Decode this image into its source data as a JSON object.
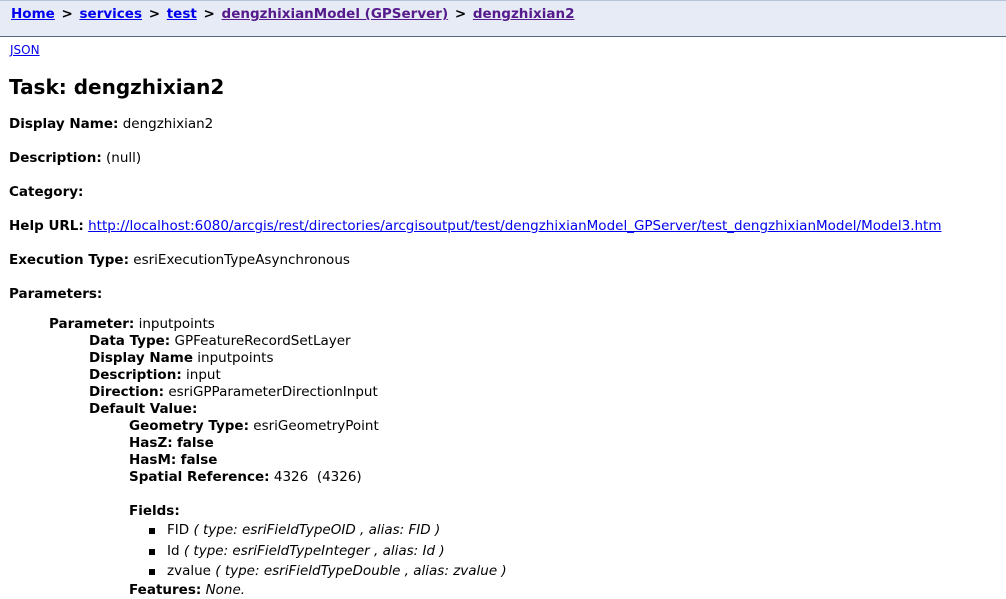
{
  "breadcrumb": {
    "items": [
      {
        "label": "Home",
        "visited": false
      },
      {
        "label": "services",
        "visited": false
      },
      {
        "label": "test",
        "visited": false
      },
      {
        "label": "dengzhixianModel (GPServer)",
        "visited": true
      },
      {
        "label": "dengzhixian2",
        "visited": true
      }
    ],
    "separator": ">"
  },
  "json_link": "JSON",
  "task": {
    "title": "Task: dengzhixian2",
    "display_name_label": "Display Name:",
    "display_name": "dengzhixian2",
    "description_label": "Description:",
    "description": "(null)",
    "category_label": "Category:",
    "category": "",
    "help_url_label": "Help URL:",
    "help_url": "http://localhost:6080/arcgis/rest/directories/arcgisoutput/test/dengzhixianModel_GPServer/test_dengzhixianModel/Model3.htm",
    "execution_type_label": "Execution Type:",
    "execution_type": "esriExecutionTypeAsynchronous",
    "parameters_label": "Parameters:"
  },
  "parameter": {
    "label": "Parameter:",
    "name": "inputpoints",
    "data_type_label": "Data Type:",
    "data_type": "GPFeatureRecordSetLayer",
    "display_name_label": "Display Name",
    "display_name": "inputpoints",
    "description_label": "Description:",
    "description": "input",
    "direction_label": "Direction:",
    "direction": "esriGPParameterDirectionInput",
    "default_value_label": "Default Value:",
    "default_value": {
      "geometry_type_label": "Geometry Type:",
      "geometry_type": "esriGeometryPoint",
      "hasz_label": "HasZ:",
      "hasz": "false",
      "hasm_label": "HasM:",
      "hasm": "false",
      "spatial_reference_label": "Spatial Reference:",
      "spatial_reference": "4326  (4326)",
      "fields_label": "Fields:",
      "fields": [
        {
          "name": "FID",
          "detail": "( type: esriFieldTypeOID , alias: FID )"
        },
        {
          "name": "Id",
          "detail": "( type: esriFieldTypeInteger , alias: Id )"
        },
        {
          "name": "zvalue",
          "detail": "( type: esriFieldTypeDouble , alias: zvalue )"
        }
      ],
      "features_label": "Features:",
      "features": "None."
    }
  },
  "colors": {
    "link": "#0000ee",
    "visited_link": "#551a8b",
    "navbar_bg": "#e6ebf5"
  }
}
